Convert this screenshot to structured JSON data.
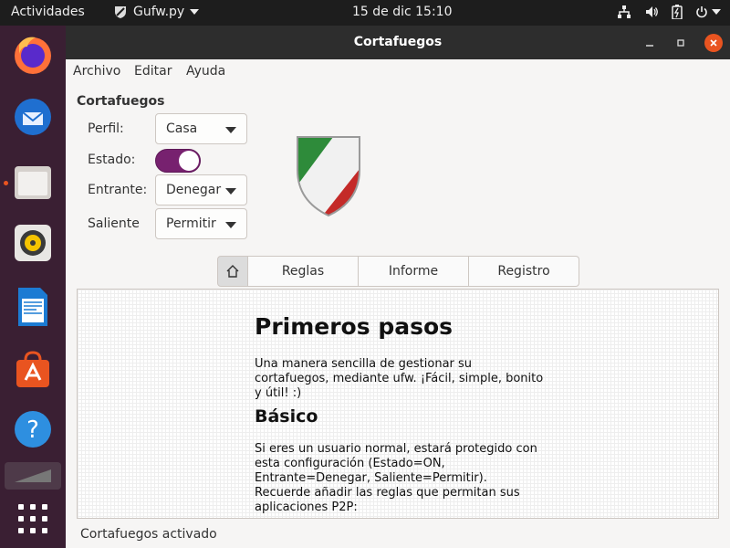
{
  "topbar": {
    "activities": "Actividades",
    "app_name": "Gufw.py",
    "clock": "15 de dic  15:10",
    "tray_icons": [
      "network-icon",
      "volume-icon",
      "battery-icon",
      "power-icon"
    ]
  },
  "dock": {
    "apps": [
      "firefox",
      "thunderbird",
      "files",
      "rhythmbox",
      "libreoffice-writer",
      "ubuntu-software",
      "help",
      "workspace-switcher",
      "show-applications"
    ]
  },
  "window": {
    "title": "Cortafuegos",
    "menu": {
      "archivo": "Archivo",
      "editar": "Editar",
      "ayuda": "Ayuda"
    },
    "section_title": "Cortafuegos",
    "perfil": {
      "label": "Perfil:",
      "value": "Casa"
    },
    "estado": {
      "label": "Estado:",
      "on": true
    },
    "entrante": {
      "label": "Entrante:",
      "value": "Denegar"
    },
    "saliente": {
      "label": "Saliente",
      "value": "Permitir"
    },
    "tabs": {
      "reglas": "Reglas",
      "informe": "Informe",
      "registro": "Registro"
    },
    "content": {
      "heading": "Primeros pasos",
      "intro": "Una manera sencilla de gestionar su cortafuegos, mediante ufw. ¡Fácil, simple, bonito y útil! :)",
      "subheading": "Básico",
      "basic_text": "Si eres un usuario normal, estará protegido con esta configuración (Estado=ON, Entrante=Denegar, Saliente=Permitir). Recuerde añadir las reglas que permitan sus aplicaciones P2P:"
    },
    "status": "Cortafuegos activado"
  },
  "colors": {
    "accent": "#e95420",
    "switch_on": "#77216f",
    "topbar": "#1d1d1d",
    "titlebar": "#2d2d2d"
  }
}
